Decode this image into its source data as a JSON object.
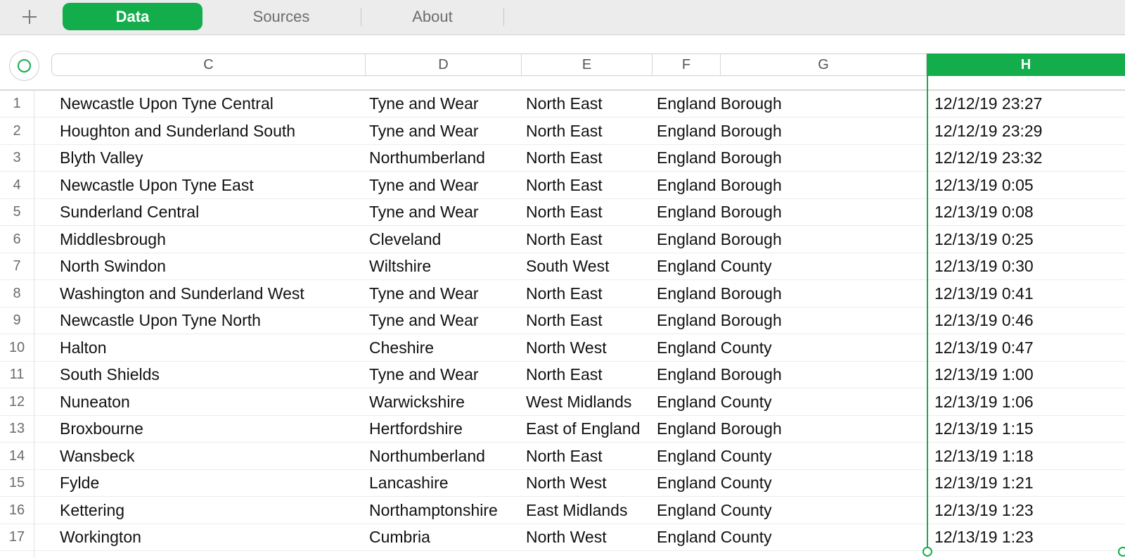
{
  "tabs": [
    {
      "label": "Data",
      "active": true
    },
    {
      "label": "Sources",
      "active": false
    },
    {
      "label": "About",
      "active": false
    }
  ],
  "icons": {
    "add_sheet": "plus-icon",
    "select_all": "circle-icon"
  },
  "colors": {
    "accent": "#14ad4c",
    "tabbar_bg": "#ececec"
  },
  "columns": [
    "C",
    "D",
    "E",
    "F",
    "G",
    "H"
  ],
  "selected_column": "H",
  "rows": [
    {
      "n": "1",
      "c": "Newcastle Upon Tyne Central",
      "d": "Tyne and Wear",
      "e": "North East",
      "f": "England Borough",
      "h": "12/12/19 23:27"
    },
    {
      "n": "2",
      "c": "Houghton and Sunderland South",
      "d": "Tyne and Wear",
      "e": "North East",
      "f": "England Borough",
      "h": "12/12/19 23:29"
    },
    {
      "n": "3",
      "c": "Blyth Valley",
      "d": "Northumberland",
      "e": "North East",
      "f": "England Borough",
      "h": "12/12/19 23:32"
    },
    {
      "n": "4",
      "c": "Newcastle Upon Tyne East",
      "d": "Tyne and Wear",
      "e": "North East",
      "f": "England Borough",
      "h": "12/13/19 0:05"
    },
    {
      "n": "5",
      "c": "Sunderland Central",
      "d": "Tyne and Wear",
      "e": "North East",
      "f": "England Borough",
      "h": "12/13/19 0:08"
    },
    {
      "n": "6",
      "c": "Middlesbrough",
      "d": "Cleveland",
      "e": "North East",
      "f": "England Borough",
      "h": "12/13/19 0:25"
    },
    {
      "n": "7",
      "c": "North Swindon",
      "d": "Wiltshire",
      "e": "South West",
      "f": "England County",
      "h": "12/13/19 0:30"
    },
    {
      "n": "8",
      "c": "Washington and Sunderland West",
      "d": "Tyne and Wear",
      "e": "North East",
      "f": "England Borough",
      "h": "12/13/19 0:41"
    },
    {
      "n": "9",
      "c": "Newcastle Upon Tyne North",
      "d": "Tyne and Wear",
      "e": "North East",
      "f": "England Borough",
      "h": "12/13/19 0:46"
    },
    {
      "n": "10",
      "c": "Halton",
      "d": "Cheshire",
      "e": "North West",
      "f": "England County",
      "h": "12/13/19 0:47"
    },
    {
      "n": "11",
      "c": "South Shields",
      "d": "Tyne and Wear",
      "e": "North East",
      "f": "England Borough",
      "h": "12/13/19 1:00"
    },
    {
      "n": "12",
      "c": "Nuneaton",
      "d": "Warwickshire",
      "e": "West Midlands",
      "f": "England County",
      "h": "12/13/19 1:06"
    },
    {
      "n": "13",
      "c": "Broxbourne",
      "d": "Hertfordshire",
      "e": "East of England",
      "f": "England Borough",
      "h": "12/13/19 1:15"
    },
    {
      "n": "14",
      "c": "Wansbeck",
      "d": "Northumberland",
      "e": "North East",
      "f": "England County",
      "h": "12/13/19 1:18"
    },
    {
      "n": "15",
      "c": "Fylde",
      "d": "Lancashire",
      "e": "North West",
      "f": "England County",
      "h": "12/13/19 1:21"
    },
    {
      "n": "16",
      "c": "Kettering",
      "d": "Northamptonshire",
      "e": "East Midlands",
      "f": "England County",
      "h": "12/13/19 1:23"
    },
    {
      "n": "17",
      "c": "Workington",
      "d": "Cumbria",
      "e": "North West",
      "f": "England County",
      "h": "12/13/19 1:23"
    }
  ]
}
